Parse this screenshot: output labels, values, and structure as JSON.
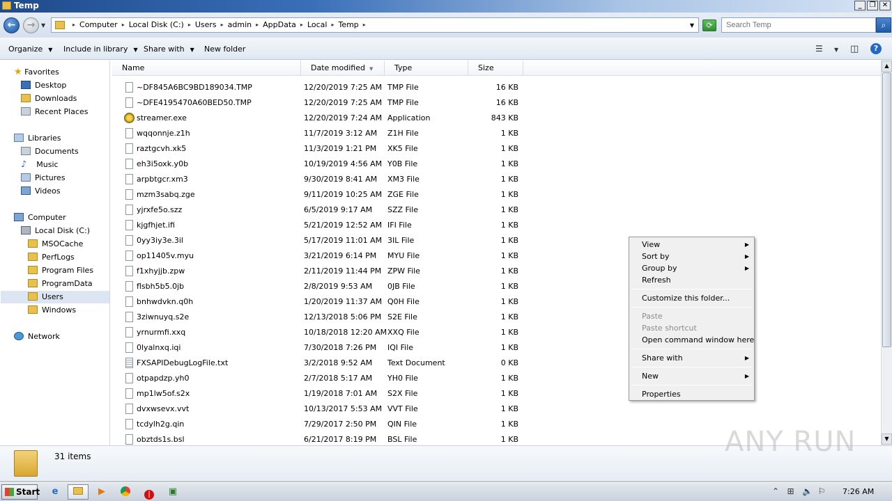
{
  "window": {
    "title": "Temp",
    "controls": [
      "minimize",
      "restore",
      "close"
    ]
  },
  "address": {
    "crumbs": [
      "Computer",
      "Local Disk (C:)",
      "Users",
      "admin",
      "AppData",
      "Local",
      "Temp"
    ]
  },
  "search": {
    "placeholder": "Search Temp"
  },
  "toolbar": {
    "organize": "Organize",
    "include_in_library": "Include in library",
    "share_with": "Share with",
    "new_folder": "New folder"
  },
  "nav": {
    "favorites": "Favorites",
    "desktop": "Desktop",
    "downloads": "Downloads",
    "recent_places": "Recent Places",
    "libraries": "Libraries",
    "documents": "Documents",
    "music": "Music",
    "pictures": "Pictures",
    "videos": "Videos",
    "computer": "Computer",
    "local_disk": "Local Disk (C:)",
    "msocache": "MSOCache",
    "perflogs": "PerfLogs",
    "program_files": "Program Files",
    "programdata": "ProgramData",
    "users": "Users",
    "windows": "Windows",
    "network": "Network"
  },
  "columns": {
    "name": "Name",
    "date": "Date modified",
    "type": "Type",
    "size": "Size"
  },
  "files": [
    {
      "name": "~DF845A6BC9BD189034.TMP",
      "date": "12/20/2019 7:25 AM",
      "type": "TMP File",
      "size": "16 KB",
      "icon": "file"
    },
    {
      "name": "~DFE4195470A60BED50.TMP",
      "date": "12/20/2019 7:25 AM",
      "type": "TMP File",
      "size": "16 KB",
      "icon": "file"
    },
    {
      "name": "streamer.exe",
      "date": "12/20/2019 7:24 AM",
      "type": "Application",
      "size": "843 KB",
      "icon": "app"
    },
    {
      "name": "wqqonnje.z1h",
      "date": "11/7/2019 3:12 AM",
      "type": "Z1H File",
      "size": "1 KB",
      "icon": "file"
    },
    {
      "name": "raztgcvh.xk5",
      "date": "11/3/2019 1:21 PM",
      "type": "XK5 File",
      "size": "1 KB",
      "icon": "file"
    },
    {
      "name": "eh3i5oxk.y0b",
      "date": "10/19/2019 4:56 AM",
      "type": "Y0B File",
      "size": "1 KB",
      "icon": "file"
    },
    {
      "name": "arpbtgcr.xm3",
      "date": "9/30/2019 8:41 AM",
      "type": "XM3 File",
      "size": "1 KB",
      "icon": "file"
    },
    {
      "name": "mzm3sabq.zge",
      "date": "9/11/2019 10:25 AM",
      "type": "ZGE File",
      "size": "1 KB",
      "icon": "file"
    },
    {
      "name": "yjrxfe5o.szz",
      "date": "6/5/2019 9:17 AM",
      "type": "SZZ File",
      "size": "1 KB",
      "icon": "file"
    },
    {
      "name": "kjgfhjet.ifi",
      "date": "5/21/2019 12:52 AM",
      "type": "IFI File",
      "size": "1 KB",
      "icon": "file"
    },
    {
      "name": "0yy3iy3e.3il",
      "date": "5/17/2019 11:01 AM",
      "type": "3IL File",
      "size": "1 KB",
      "icon": "file"
    },
    {
      "name": "op11405v.myu",
      "date": "3/21/2019 6:14 PM",
      "type": "MYU File",
      "size": "1 KB",
      "icon": "file"
    },
    {
      "name": "f1xhyjjb.zpw",
      "date": "2/11/2019 11:44 PM",
      "type": "ZPW File",
      "size": "1 KB",
      "icon": "file"
    },
    {
      "name": "flsbh5b5.0jb",
      "date": "2/8/2019 9:53 AM",
      "type": "0JB File",
      "size": "1 KB",
      "icon": "file"
    },
    {
      "name": "bnhwdvkn.q0h",
      "date": "1/20/2019 11:37 AM",
      "type": "Q0H File",
      "size": "1 KB",
      "icon": "file"
    },
    {
      "name": "3ziwnuyq.s2e",
      "date": "12/13/2018 5:06 PM",
      "type": "S2E File",
      "size": "1 KB",
      "icon": "file"
    },
    {
      "name": "yrnurmfi.xxq",
      "date": "10/18/2018 12:20 AM",
      "type": "XXQ File",
      "size": "1 KB",
      "icon": "file"
    },
    {
      "name": "0lyalnxq.iqi",
      "date": "7/30/2018 7:26 PM",
      "type": "IQI File",
      "size": "1 KB",
      "icon": "file"
    },
    {
      "name": "FXSAPIDebugLogFile.txt",
      "date": "3/2/2018 9:52 AM",
      "type": "Text Document",
      "size": "0 KB",
      "icon": "txt"
    },
    {
      "name": "otpapdzp.yh0",
      "date": "2/7/2018 5:17 AM",
      "type": "YH0 File",
      "size": "1 KB",
      "icon": "file"
    },
    {
      "name": "mp1lw5of.s2x",
      "date": "1/19/2018 7:01 AM",
      "type": "S2X File",
      "size": "1 KB",
      "icon": "file"
    },
    {
      "name": "dvxwsevx.vvt",
      "date": "10/13/2017 5:53 AM",
      "type": "VVT File",
      "size": "1 KB",
      "icon": "file"
    },
    {
      "name": "tcdylh2g.qin",
      "date": "7/29/2017 2:50 PM",
      "type": "QIN File",
      "size": "1 KB",
      "icon": "file"
    },
    {
      "name": "obztds1s.bsl",
      "date": "6/21/2017 8:19 PM",
      "type": "BSL File",
      "size": "1 KB",
      "icon": "file"
    }
  ],
  "context_menu": {
    "view": "View",
    "sort_by": "Sort by",
    "group_by": "Group by",
    "refresh": "Refresh",
    "customize": "Customize this folder...",
    "paste": "Paste",
    "paste_shortcut": "Paste shortcut",
    "open_cmd": "Open command window here",
    "share_with": "Share with",
    "new": "New",
    "properties": "Properties"
  },
  "details": {
    "item_count": "31 items"
  },
  "taskbar": {
    "start": "Start",
    "clock": "7:26 AM"
  },
  "watermark": "ANY RUN"
}
